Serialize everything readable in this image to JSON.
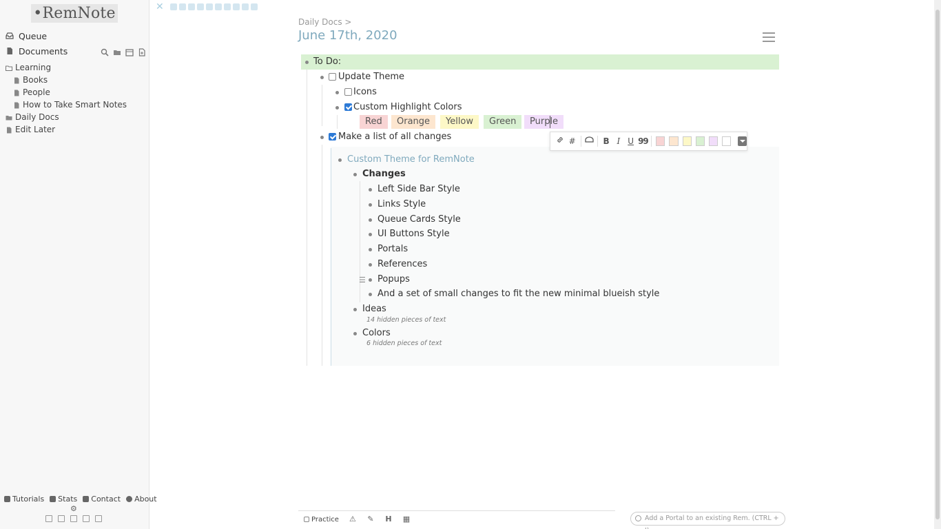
{
  "sidebar": {
    "logo": "•RemNote",
    "queue_label": "Queue",
    "documents_label": "Documents",
    "tree": [
      {
        "label": "Learning",
        "icon": "folder-icon"
      },
      {
        "label": "Books",
        "icon": "document-icon"
      },
      {
        "label": "People",
        "icon": "document-icon"
      },
      {
        "label": "How to Take Smart Notes",
        "icon": "document-icon"
      },
      {
        "label": "Daily Docs",
        "icon": "folder-icon"
      },
      {
        "label": "Edit Later",
        "icon": "document-icon"
      }
    ],
    "footer": {
      "tutorials": "Tutorials",
      "stats": "Stats",
      "contact": "Contact",
      "about": "About"
    }
  },
  "document": {
    "breadcrumb": "Daily Docs >",
    "title": "June 17th, 2020",
    "items": {
      "todo": "To Do:",
      "update_theme": "Update Theme",
      "icons": "Icons",
      "custom_highlight": "Custom Highlight Colors",
      "make_list": "Make a list of all changes",
      "portal_title": "Custom Theme for RemNote",
      "changes": "Changes",
      "change_items": [
        "Left Side Bar Style",
        "Links Style",
        "Queue Cards Style",
        "UI Buttons Style",
        "Portals",
        "References",
        "Popups",
        "And a set of small changes to fit the new minimal blueish style"
      ],
      "ideas": "Ideas",
      "ideas_hidden": "14 hidden pieces of text",
      "colors": "Colors",
      "colors_hidden": "6 hidden pieces of text"
    },
    "checkboxes": {
      "update_theme": false,
      "icons": false,
      "custom_highlight": true,
      "make_list": true
    },
    "highlight_chips": [
      {
        "label": "Red",
        "color": "#f8d4d4"
      },
      {
        "label": "Orange",
        "color": "#fde6cf"
      },
      {
        "label": "Yellow",
        "color": "#fdf8c7"
      },
      {
        "label": "Green",
        "color": "#d9f1d2"
      },
      {
        "label": "Purple",
        "color": "#f1ddfa"
      }
    ]
  },
  "format_toolbar": {
    "buttons": [
      "link-icon",
      "hash-icon",
      "cloze-icon",
      "bold-icon",
      "italic-icon",
      "underline-icon",
      "quote-icon"
    ],
    "bold_glyph": "B",
    "italic_glyph": "I",
    "underline_glyph": "U",
    "quote_glyph": "99",
    "hash_glyph": "#",
    "swatches": [
      "#f8d4d4",
      "#fde6cf",
      "#fdf8c7",
      "#d9f1d2",
      "#f1ddfa",
      "#ffffff"
    ]
  },
  "bottom_bar": {
    "practice_label": "Practice",
    "heading_glyph": "H",
    "portal_placeholder": "Add a Portal to an existing Rem. (CTRL + I)"
  },
  "colors": {
    "accent": "#7fa9bd",
    "todo_highlight": "#d9f1d2",
    "checkbox_checked": "#2d7ad6"
  }
}
